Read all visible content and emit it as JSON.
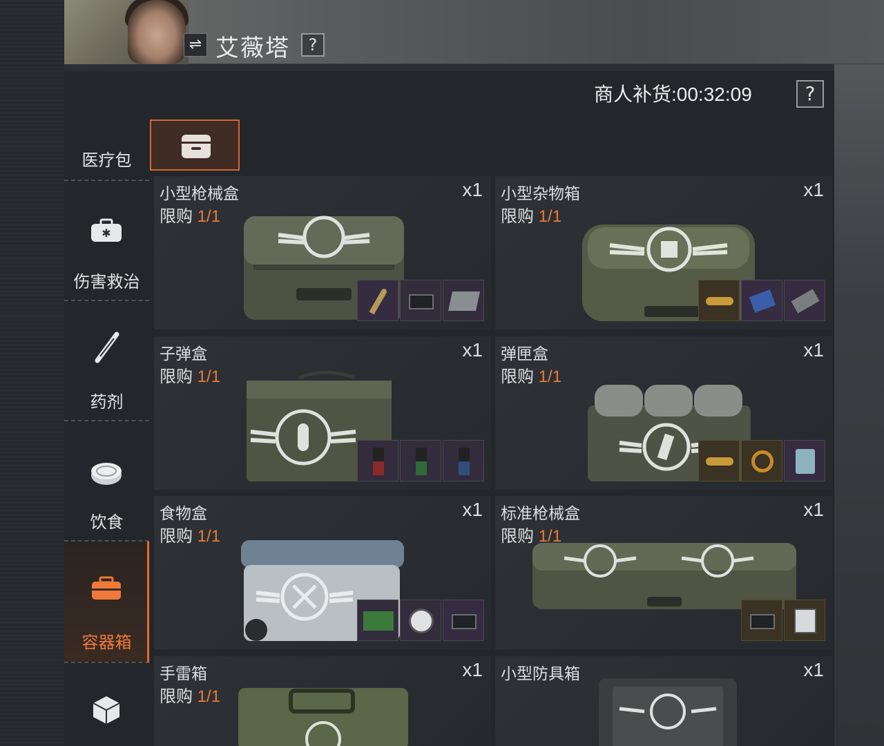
{
  "character": {
    "name": "艾薇塔",
    "help": "?",
    "swap": "⇌"
  },
  "restock": {
    "label": "商人补货:00:32:09",
    "help": "?"
  },
  "sidebar": {
    "items": [
      {
        "label": "医疗包",
        "icon": "medkit-icon",
        "active": false
      },
      {
        "label": "伤害救治",
        "icon": "first-aid-bag-icon",
        "active": false
      },
      {
        "label": "药剂",
        "icon": "syringe-icon",
        "active": false
      },
      {
        "label": "饮食",
        "icon": "food-can-icon",
        "active": false
      },
      {
        "label": "容器箱",
        "icon": "container-box-icon",
        "active": true
      },
      {
        "label": "",
        "icon": "supply-cube-icon",
        "active": false
      }
    ]
  },
  "subtab": {
    "icon": "storage-box-icon"
  },
  "cards": [
    {
      "name": "小型枪械盒",
      "limit_label": "限购",
      "limit_value": "1/1",
      "qty": "x1",
      "thumbs": [
        "bullet-icon",
        "radio-device-icon",
        "server-box-icon"
      ]
    },
    {
      "name": "小型杂物箱",
      "limit_label": "限购",
      "limit_value": "1/1",
      "qty": "x1",
      "thumbs": [
        "gold-cheetah-icon",
        "circuit-board-icon",
        "tool-kit-icon"
      ]
    },
    {
      "name": "子弹盒",
      "limit_label": "限购",
      "limit_value": "1/1",
      "qty": "x1",
      "thumbs": [
        "red-bottle-icon",
        "green-bottle-icon",
        "blue-bottle-icon"
      ]
    },
    {
      "name": "弹匣盒",
      "limit_label": "限购",
      "limit_value": "1/1",
      "qty": "x1",
      "thumbs": [
        "gold-cheetah-icon",
        "gold-ring-icon",
        "fuel-can-icon"
      ]
    },
    {
      "name": "食物盒",
      "limit_label": "限购",
      "limit_value": "1/1",
      "qty": "x1",
      "thumbs": [
        "circuit-board-icon",
        "pressure-gauge-icon",
        "radio-device-icon"
      ]
    },
    {
      "name": "标准枪械盒",
      "limit_label": "限购",
      "limit_value": "1/1",
      "qty": "x1",
      "thumbs": [
        "radio-device-icon",
        "control-panel-icon"
      ]
    },
    {
      "name": "手雷箱",
      "limit_label": "限购",
      "limit_value": "1/1",
      "qty": "x1",
      "thumbs": []
    },
    {
      "name": "小型防具箱",
      "limit_label": "",
      "limit_value": "",
      "qty": "x1",
      "thumbs": []
    }
  ],
  "colors": {
    "accent": "#ec7b36",
    "panel": "#23272b",
    "card": "#2b2f33",
    "active_border": "#e86a2e"
  }
}
